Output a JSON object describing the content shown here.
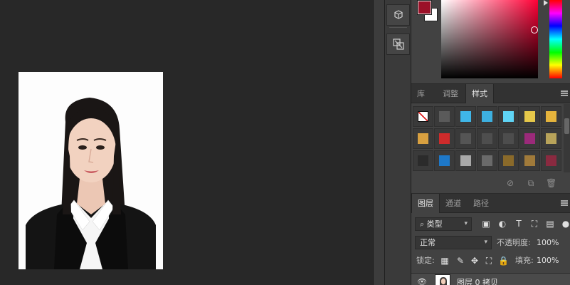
{
  "styles_tabs": [
    "库",
    "调整",
    "样式"
  ],
  "styles_active_tab": 2,
  "layers_tabs": [
    "图层",
    "通道",
    "路径"
  ],
  "layers_active_tab": 0,
  "colors": {
    "foreground": "#9b1128",
    "background": "#ffffff",
    "selected_hue": "#ff0036"
  },
  "layers": {
    "filter_label": "类型",
    "blend_mode": "正常",
    "opacity_label": "不透明度:",
    "opacity_value": "100%",
    "lock_label": "锁定:",
    "fill_label": "填充:",
    "fill_value": "100%",
    "layer_name": "图层 0 拷贝"
  },
  "dock_icons": [
    "3d-cube-icon",
    "transform-icon"
  ],
  "style_swatches": [
    "#ffffff",
    "#5a5a5a",
    "#3fb6e8",
    "#3db0e0",
    "#5fd4f5",
    "#e6c84a",
    "#e6b43c",
    "#d8a040",
    "#cf2b2b",
    "#555555",
    "#4e4e4e",
    "#4d4d4d",
    "#9b2a7a",
    "#b8a35a",
    "#2b2b2b",
    "#1e78c8",
    "#a8a8a8",
    "#6a6a6a",
    "#8a6a2a",
    "#a07a3a",
    "#8a2a40"
  ]
}
